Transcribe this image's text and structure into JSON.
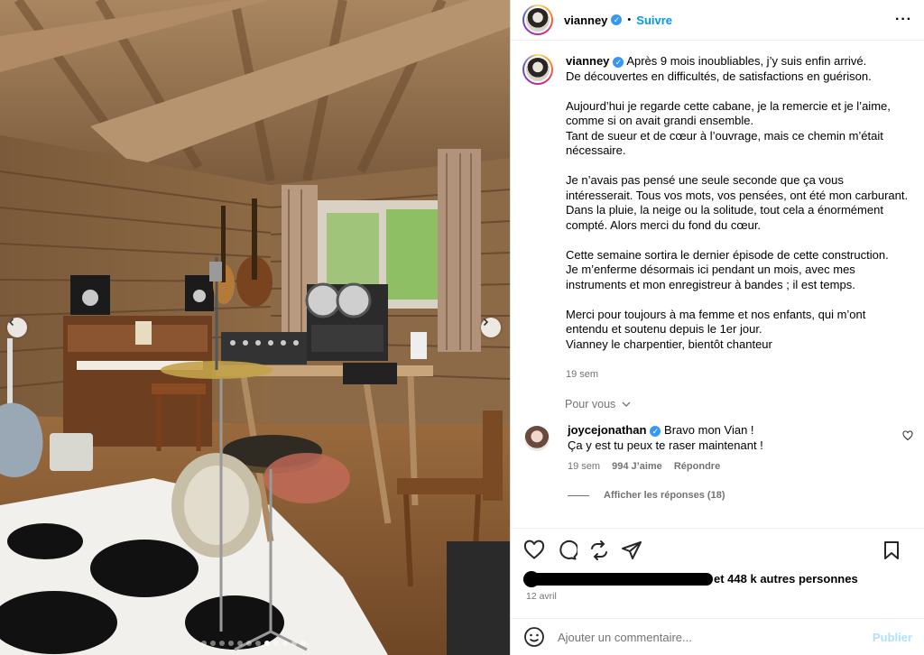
{
  "post": {
    "username": "vianney",
    "follow_label": "Suivre",
    "header_separator": "•",
    "more_icon": "more-horizontal-icon",
    "caption_paragraphs": [
      "Après 9 mois inoubliables, j’y suis enfin arrivé.\nDe découvertes en difficultés, de satisfactions en guérison.",
      "Aujourd’hui je regarde cette cabane, je la remercie et je l’aime, comme si on avait grandi ensemble.\nTant de sueur et de cœur à l’ouvrage, mais ce chemin m’était nécessaire.",
      "Je n’avais pas pensé une seule seconde que ça vous intéresserait. Tous vos mots, vos pensées, ont été mon carburant. Dans la pluie, la neige ou la solitude, tout cela a énormément compté. Alors merci du fond du cœur.",
      "Cette semaine sortira le dernier épisode de cette construction.\nJe m’enferme désormais ici pendant un mois, avec mes instruments et mon enregistreur à bandes ; il est temps.",
      "Merci pour toujours à ma femme et nos enfants, qui m’ont entendu et soutenu depuis le 1er jour.\nVianney le charpentier, bientôt chanteur"
    ],
    "caption_time": "19 sem",
    "for_you_label": "Pour vous",
    "comment": {
      "username": "joycejonathan",
      "text": "Bravo mon Vian !\nÇa y est tu peux te raser maintenant !",
      "time": "19 sem",
      "likes": "994 J’aime",
      "reply_label": "Répondre",
      "view_replies": "Afficher les réponses (18)"
    },
    "likes_text": "et 448 k autres personnes",
    "date": "12 avril",
    "add_comment_placeholder": "Ajouter un commentaire...",
    "publish_label": "Publier"
  },
  "carousel": {
    "total": 12,
    "active_index": 7
  },
  "colors": {
    "accent": "#0095f6",
    "verified": "#3897f0",
    "muted": "#737373",
    "publish_disabled": "#b2dffc"
  }
}
